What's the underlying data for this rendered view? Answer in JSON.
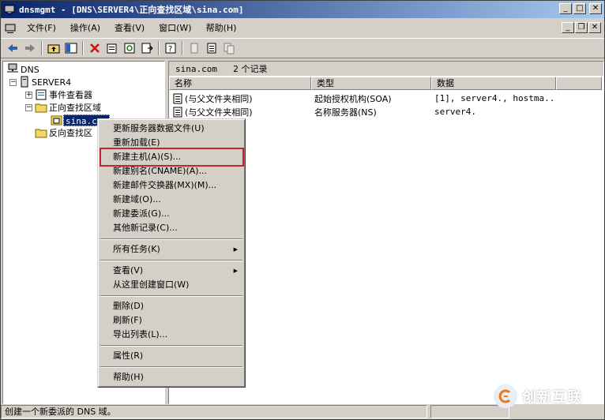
{
  "window": {
    "title": "dnsmgmt - [DNS\\SERVER4\\正向查找区域\\sina.com]"
  },
  "menu": [
    "文件(F)",
    "操作(A)",
    "查看(V)",
    "窗口(W)",
    "帮助(H)"
  ],
  "toolbar": [
    "back-icon",
    "forward-icon",
    "up-folder-icon",
    "show-hide-tree-icon",
    "delete-icon",
    "properties-icon",
    "refresh-icon",
    "export-icon",
    "help-icon",
    "record-icon",
    "new-record-icon",
    "copy-icon"
  ],
  "tree": {
    "root": "DNS",
    "server": "SERVER4",
    "event_viewer": "事件查看器",
    "forward_zones": "正向查找区域",
    "zone": "sina.com",
    "reverse_zones": "反向查找区"
  },
  "detail": {
    "zone_name": "sina.com",
    "record_count": "2 个记录",
    "columns": [
      "名称",
      "类型",
      "数据"
    ],
    "rows": [
      {
        "name": "(与父文件夹相同)",
        "type": "起始授权机构(SOA)",
        "data": "[1], server4., hostma..."
      },
      {
        "name": "(与父文件夹相同)",
        "type": "名称服务器(NS)",
        "data": "server4."
      }
    ]
  },
  "context_menu": {
    "group1": [
      "更新服务器数据文件(U)",
      "重新加载(E)",
      "新建主机(A)(S)...",
      "新建别名(CNAME)(A)...",
      "新建邮件交换器(MX)(M)...",
      "新建域(O)...",
      "新建委派(G)...",
      "其他新记录(C)..."
    ],
    "group2": [
      "所有任务(K)"
    ],
    "group3": [
      "查看(V)",
      "从这里创建窗口(W)"
    ],
    "group4": [
      "删除(D)",
      "刷新(F)",
      "导出列表(L)..."
    ],
    "group5": [
      "属性(R)"
    ],
    "group6": [
      "帮助(H)"
    ],
    "highlighted": "新建主机(A)(S)..."
  },
  "status": {
    "text": "创建一个新委派的 DNS 域。"
  },
  "watermark": {
    "text": "创新互联"
  },
  "colors": {
    "title_start": "#0a246a",
    "title_end": "#a6caf0",
    "highlight_box": "#c0262b",
    "selection": "#0a246a"
  }
}
